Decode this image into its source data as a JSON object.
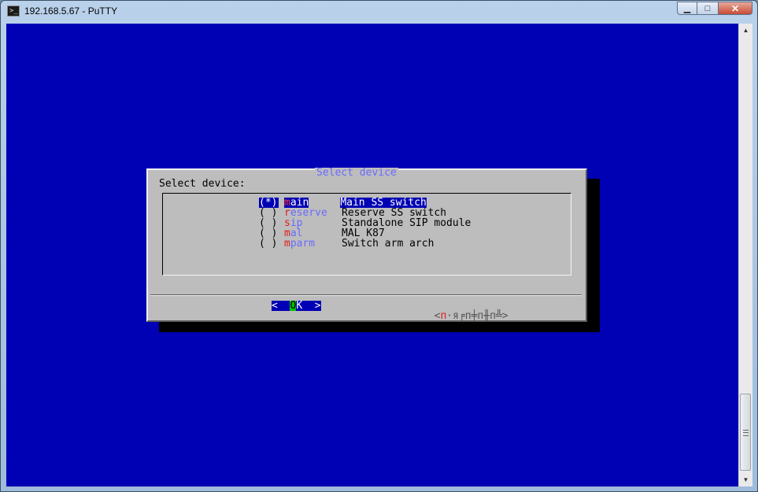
{
  "window": {
    "title": "192.168.5.67 - PuTTY",
    "icon": "putty-terminal-icon"
  },
  "controls": {
    "minimize": "▁",
    "maximize": "□",
    "close": "✕"
  },
  "dialog": {
    "title": "Select device",
    "prompt": "Select device:",
    "items": [
      {
        "radio": "(*)",
        "tag_hotkey": "m",
        "tag_rest": "ain",
        "description": "Main SS switch",
        "selected": true
      },
      {
        "radio": "( )",
        "tag_hotkey": "r",
        "tag_rest": "eserve",
        "description": "Reserve SS switch",
        "selected": false
      },
      {
        "radio": "( )",
        "tag_hotkey": "s",
        "tag_rest": "ip",
        "description": "Standalone SIP module",
        "selected": false
      },
      {
        "radio": "( )",
        "tag_hotkey": "m",
        "tag_rest": "al",
        "description": "MAL K87",
        "selected": false
      },
      {
        "radio": "( )",
        "tag_hotkey": "m",
        "tag_rest": "parm",
        "description": "Switch arm arch",
        "selected": false
      }
    ],
    "ok_button": {
      "left": "<  ",
      "hotkey": "O",
      "rest": "K  >"
    },
    "cancel_button": {
      "left": "<",
      "hotkey": "п",
      "rest": "·я╒п╪п╫п╩>"
    }
  },
  "colors": {
    "terminal_bg": "#0000b5",
    "dialog_bg": "#bdbdbd",
    "accent": "#6a6aff",
    "hotkey": "#e01c1c",
    "ok_hotkey": "#00c000"
  }
}
